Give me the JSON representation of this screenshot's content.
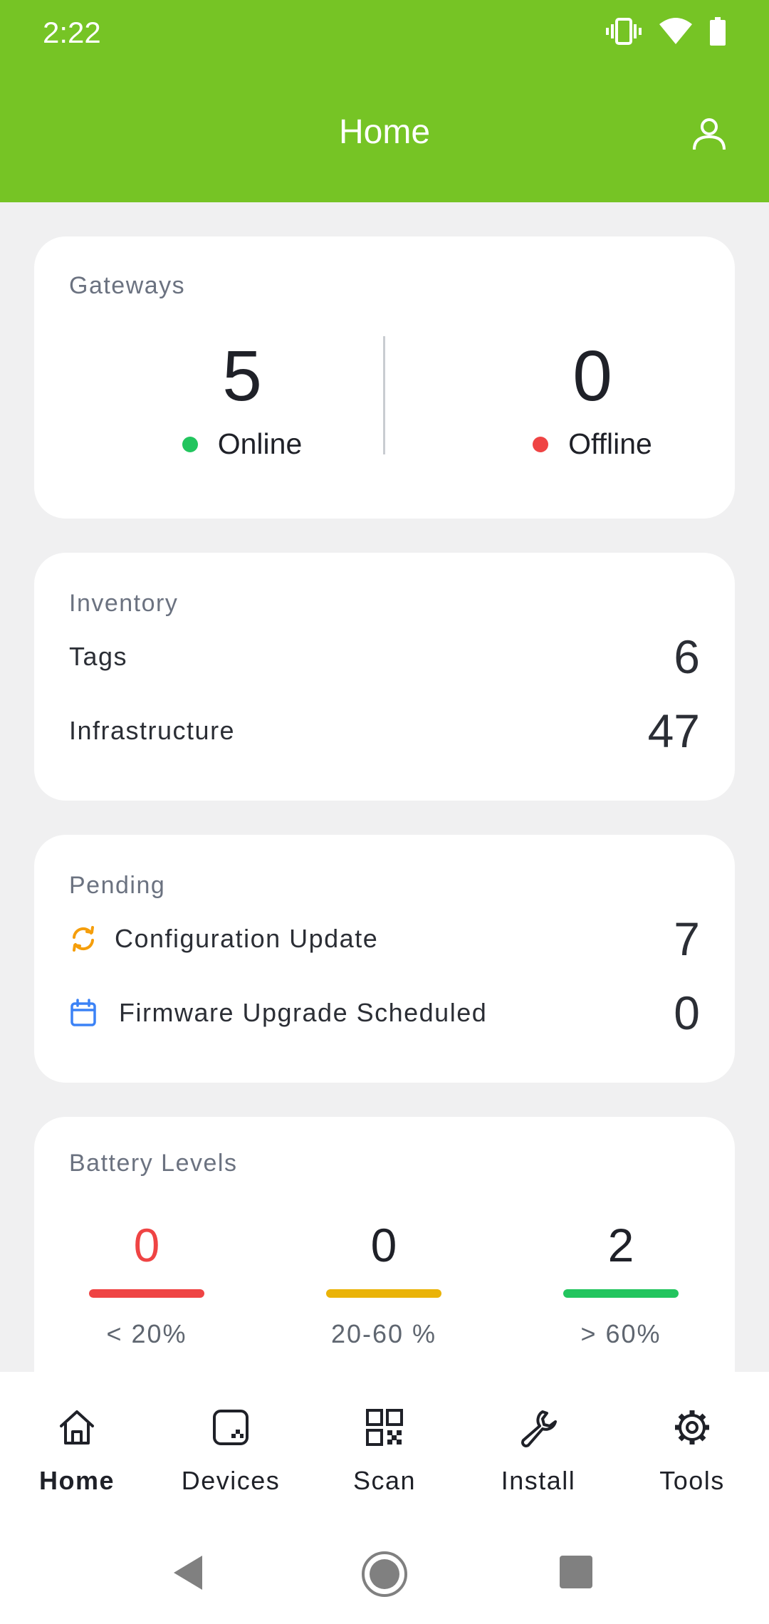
{
  "status_bar": {
    "time": "2:22",
    "icons": [
      "vibrate-icon",
      "wifi-icon",
      "battery-icon"
    ]
  },
  "app_bar": {
    "title": "Home",
    "profile_icon": "profile-icon",
    "background": "#76c425"
  },
  "gateways": {
    "title": "Gateways",
    "online": {
      "count": "5",
      "label": "Online",
      "color": "#22c55e"
    },
    "offline": {
      "count": "0",
      "label": "Offline",
      "color": "#ef4444"
    }
  },
  "inventory": {
    "title": "Inventory",
    "rows": [
      {
        "label": "Tags",
        "value": "6"
      },
      {
        "label": "Infrastructure",
        "value": "47"
      }
    ]
  },
  "pending": {
    "title": "Pending",
    "rows": [
      {
        "label": "Configuration Update",
        "value": "7",
        "icon": "refresh-icon",
        "icon_color": "#f59e0b"
      },
      {
        "label": "Firmware Upgrade Scheduled",
        "value": "0",
        "icon": "calendar-icon",
        "icon_color": "#3b82f6"
      }
    ]
  },
  "battery": {
    "title": "Battery Levels",
    "levels": [
      {
        "count": "0",
        "range": "< 20%",
        "color": "#ef4444"
      },
      {
        "count": "0",
        "range": "20-60 %",
        "color": "#eab308"
      },
      {
        "count": "2",
        "range": "> 60%",
        "color": "#22c55e"
      }
    ]
  },
  "bottom_nav": {
    "items": [
      {
        "label": "Home",
        "icon": "home-icon",
        "active": true
      },
      {
        "label": "Devices",
        "icon": "devices-icon",
        "active": false
      },
      {
        "label": "Scan",
        "icon": "qr-code-icon",
        "active": false
      },
      {
        "label": "Install",
        "icon": "wrench-icon",
        "active": false
      },
      {
        "label": "Tools",
        "icon": "gear-icon",
        "active": false
      }
    ]
  },
  "system_nav": {
    "icons": [
      "back-icon",
      "home-circle-icon",
      "recents-icon"
    ]
  }
}
